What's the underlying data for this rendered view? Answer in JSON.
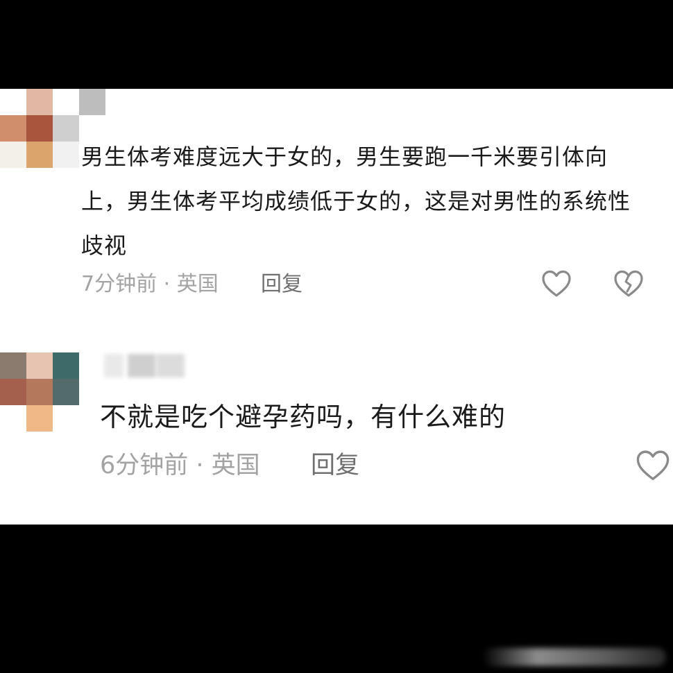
{
  "comments": [
    {
      "text": "男生体考难度远大于女的，男生要跑一千米要引体向上，男生体考平均成绩低于女的，这是对男性的系统性歧视",
      "time": "7分钟前",
      "location": "英国",
      "reply_label": "回复",
      "like_icon": "heart-outline-icon",
      "dislike_icon": "broken-heart-icon"
    },
    {
      "text": "不就是吃个避孕药吗，有什么难的",
      "time": "6分钟前",
      "location": "英国",
      "reply_label": "回复",
      "like_icon": "heart-outline-icon"
    }
  ],
  "separator": " · ",
  "colors": {
    "text": "#1a1a1a",
    "meta": "#a3a3a3",
    "reply": "#6f6f6f",
    "icon": "#8a8a8a"
  }
}
